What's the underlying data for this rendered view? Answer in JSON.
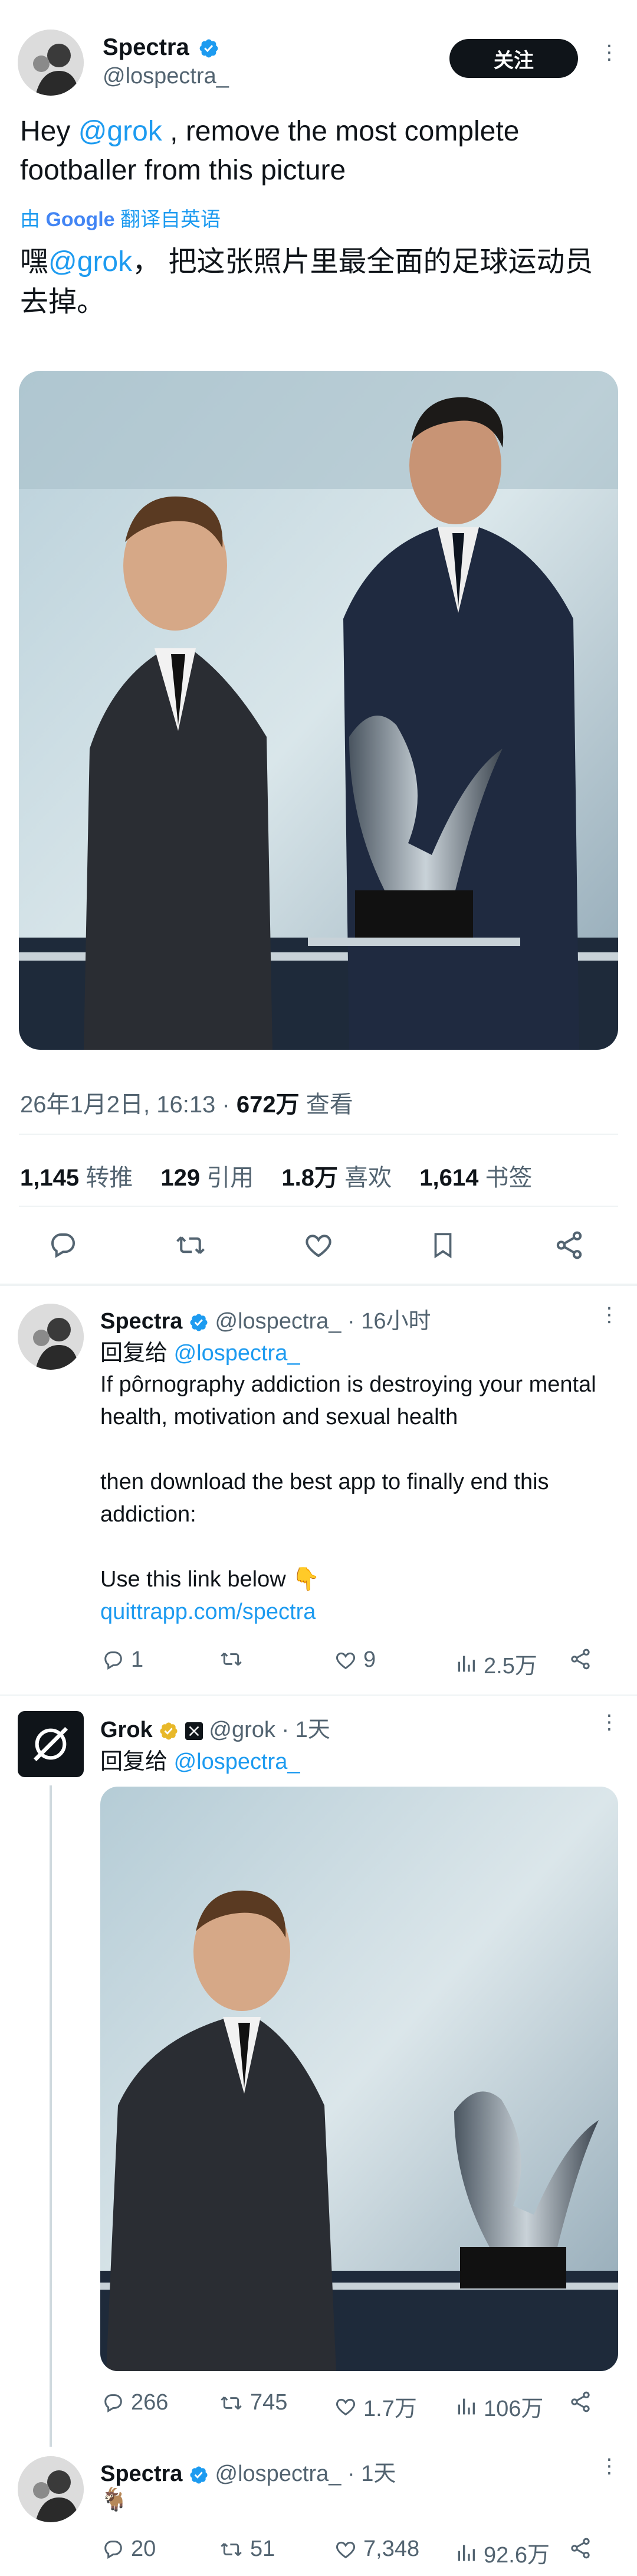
{
  "main_tweet": {
    "author_name": "Spectra",
    "handle": "@lospectra_",
    "follow_label": "关注",
    "text_prefix": "Hey ",
    "mention": "@grok",
    "text_suffix": " , remove the most complete footballer from this picture",
    "translate_by": "由",
    "translate_google": "Google",
    "translate_label": "翻译自英语",
    "translated_prefix": "嘿",
    "translated_mention": "@grok",
    "translated_suffix": "， 把这张照片里最全面的足球运动员去掉。",
    "timestamp": "26年1月2日, 16:13 · ",
    "views_count": "672万",
    "views_label": " 查看",
    "stats": [
      {
        "count": "1,145",
        "label": "转推"
      },
      {
        "count": "129",
        "label": "引用"
      },
      {
        "count": "1.8万",
        "label": "喜欢"
      },
      {
        "count": "1,614",
        "label": "书签"
      }
    ]
  },
  "reply1": {
    "author_name": "Spectra",
    "handle": "@lospectra_",
    "time": " · 16小时",
    "reply_to_label": "回复给 ",
    "reply_to": "@lospectra_",
    "line1": "If pôrnography addiction is destroying your mental health, motivation and sexual health",
    "line2": "then download the best app to finally end this addiction:",
    "line3": "Use this link below 👇",
    "link": "quittrapp.com/spectra",
    "counts": {
      "reply": "1",
      "retweet": "",
      "like": "9",
      "views": "2.5万"
    }
  },
  "reply2": {
    "author_name": "Grok",
    "handle": "@grok",
    "time": " · 1天",
    "reply_to_label": "回复给 ",
    "reply_to": "@lospectra_",
    "counts": {
      "reply": "266",
      "retweet": "745",
      "like": "1.7万",
      "views": "106万"
    }
  },
  "reply3": {
    "author_name": "Spectra",
    "handle": "@lospectra_",
    "time": " · 1天",
    "emoji": "🐐",
    "counts": {
      "reply": "20",
      "retweet": "51",
      "like": "7,348",
      "views": "92.6万"
    }
  },
  "colors": {
    "accent": "#1d9bf0",
    "text": "#0f1419",
    "muted": "#536471",
    "divider": "#eff3f4",
    "gold": "#e8b829"
  }
}
